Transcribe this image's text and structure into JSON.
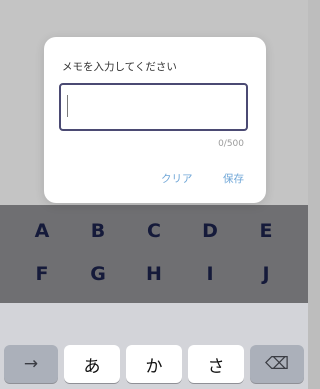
{
  "dialog": {
    "title": "メモを入力してください",
    "input_value": "",
    "counter": "0/500",
    "clear_label": "クリア",
    "save_label": "保存"
  },
  "letters": {
    "row1": [
      "A",
      "B",
      "C",
      "D",
      "E"
    ],
    "row2": [
      "F",
      "G",
      "H",
      "I",
      "J"
    ]
  },
  "keyboard": {
    "next_key": "→",
    "keys": [
      "あ",
      "か",
      "さ"
    ],
    "delete_key": "⌫"
  },
  "colors": {
    "accent": "#6fa6d7",
    "input_border": "#4b4a73",
    "letter_text": "#151a3a"
  }
}
